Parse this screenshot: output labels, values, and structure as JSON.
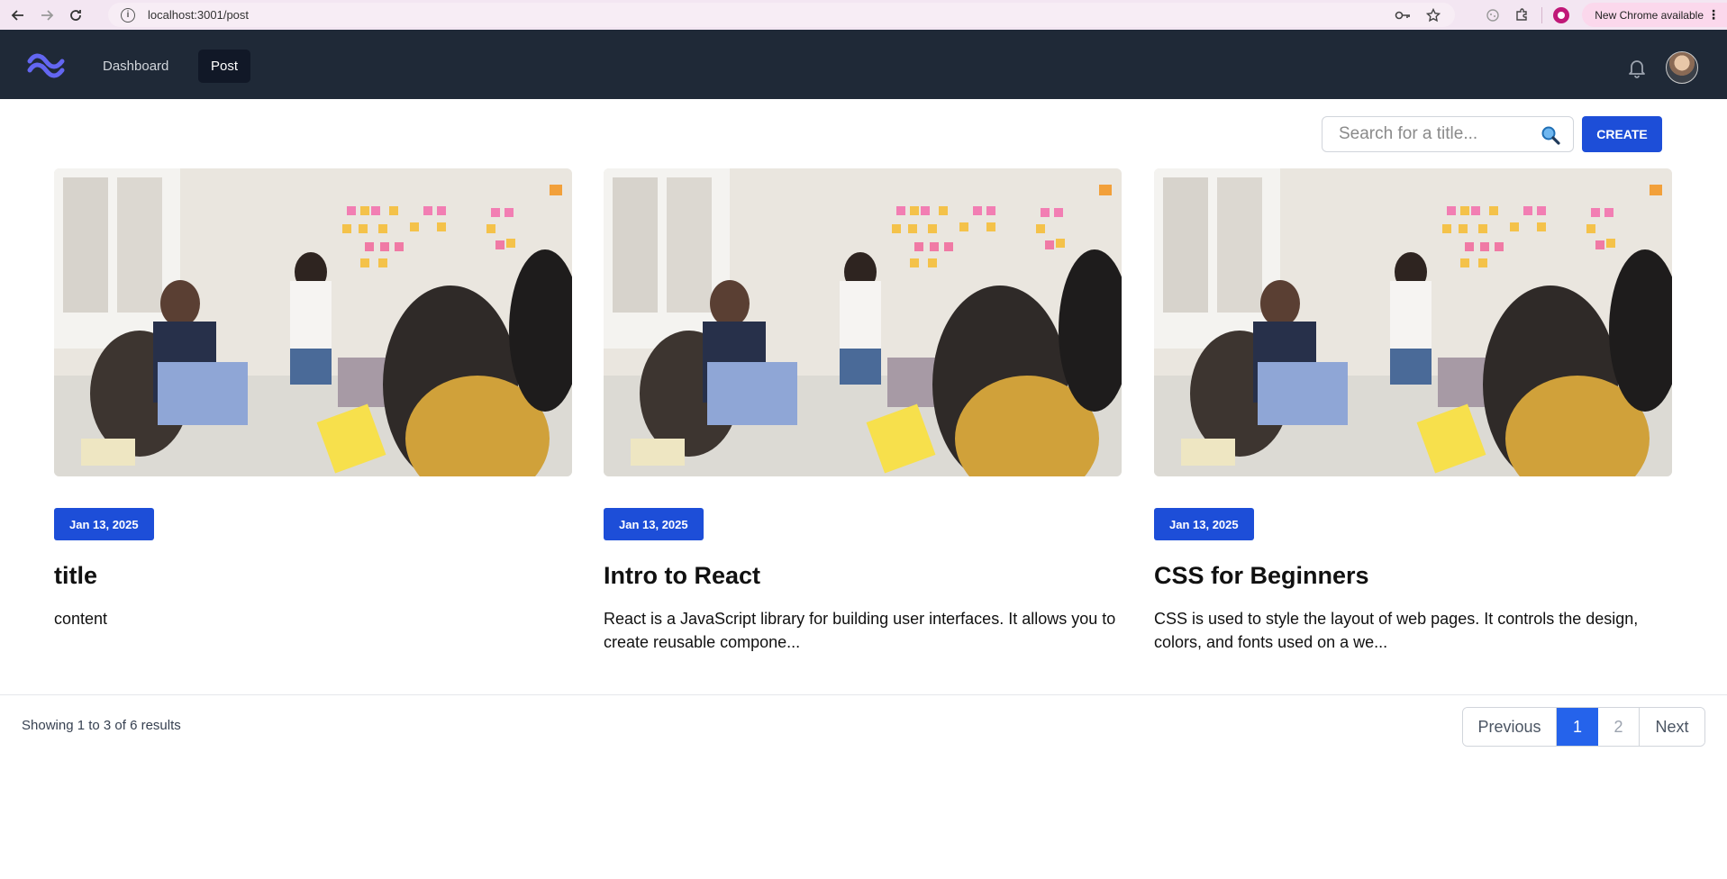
{
  "browser": {
    "url": "localhost:3001/post",
    "update_label": "New Chrome available"
  },
  "nav": {
    "items": [
      {
        "label": "Dashboard",
        "active": false
      },
      {
        "label": "Post",
        "active": true
      }
    ]
  },
  "toolbar": {
    "search_placeholder": "Search for a title...",
    "create_label": "CREATE"
  },
  "posts": [
    {
      "date": "Jan 13, 2025",
      "title": "title",
      "content": "content"
    },
    {
      "date": "Jan 13, 2025",
      "title": "Intro to React",
      "content": "React is a JavaScript library for building user interfaces. It allows you to create reusable compone..."
    },
    {
      "date": "Jan 13, 2025",
      "title": "CSS for Beginners",
      "content": "CSS is used to style the layout of web pages. It controls the design, colors, and fonts used on a we..."
    }
  ],
  "pagination": {
    "summary": "Showing 1 to 3 of 6 results",
    "previous_label": "Previous",
    "pages": [
      "1",
      "2"
    ],
    "current_page": "1",
    "next_label": "Next"
  },
  "colors": {
    "nav_bg": "#1f2937",
    "accent": "#1d4ed8",
    "chrome_bg": "#f3e6f2"
  }
}
